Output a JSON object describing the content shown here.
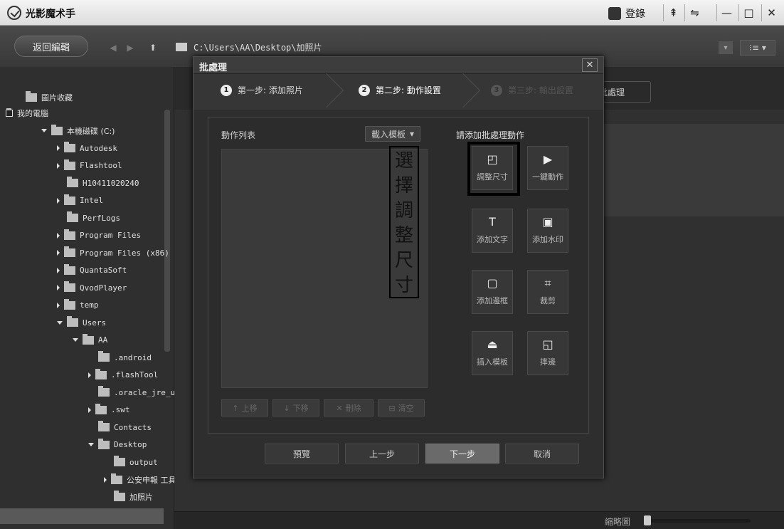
{
  "app": {
    "title": "光影魔术手",
    "login": "登錄"
  },
  "window_controls": [
    "⇞",
    "⇋",
    "—",
    "□",
    "✕"
  ],
  "toolbar": {
    "back_edit": "返回編輯",
    "path": "C:\\Users\\AA\\Desktop\\加照片",
    "view": "⁝≡ ▾"
  },
  "sidebar": {
    "items": [
      {
        "label": "圖片收藏",
        "indent": 0
      },
      {
        "label": "我的電腦",
        "indent": 0
      },
      {
        "label": "本機磁碟 (C:)",
        "indent": 1
      },
      {
        "label": "Autodesk",
        "indent": 2
      },
      {
        "label": "Flashtool",
        "indent": 2
      },
      {
        "label": "H10411020240",
        "indent": 2
      },
      {
        "label": "Intel",
        "indent": 2
      },
      {
        "label": "PerfLogs",
        "indent": 2
      },
      {
        "label": "Program Files",
        "indent": 2
      },
      {
        "label": "Program Files (x86)",
        "indent": 2
      },
      {
        "label": "QuantaSoft",
        "indent": 2
      },
      {
        "label": "QvodPlayer",
        "indent": 2
      },
      {
        "label": "temp",
        "indent": 2
      },
      {
        "label": "Users",
        "indent": 2
      },
      {
        "label": "AA",
        "indent": 3
      },
      {
        "label": ".android",
        "indent": 4
      },
      {
        "label": ".flashTool",
        "indent": 4
      },
      {
        "label": ".oracle_jre_usage",
        "indent": 4
      },
      {
        "label": ".swt",
        "indent": 4
      },
      {
        "label": "Contacts",
        "indent": 4
      },
      {
        "label": "Desktop",
        "indent": 4
      },
      {
        "label": "output",
        "indent": 5
      },
      {
        "label": "公安申報  工具",
        "indent": 5
      },
      {
        "label": "加照片",
        "indent": 5
      }
    ]
  },
  "main": {
    "batch_tab_partial": "批處理",
    "thumb_label": "縮略圖"
  },
  "dialog": {
    "title": "批處理",
    "close": "✕",
    "steps": [
      {
        "num": "1",
        "label": "第一步: 添加照片"
      },
      {
        "num": "2",
        "label": "第二步: 動作設置"
      },
      {
        "num": "3",
        "label": "第三步: 輸出設置"
      }
    ],
    "action_list_label": "動作列表",
    "load_template": "載入模板",
    "add_action_label": "請添加批處理動作",
    "list_buttons": [
      {
        "icon": "↑",
        "label": "上移"
      },
      {
        "icon": "↓",
        "label": "下移"
      },
      {
        "icon": "✕",
        "label": "刪除"
      },
      {
        "icon": "⊟",
        "label": "清空"
      }
    ],
    "actions": [
      {
        "icon": "◰",
        "label": "調整尺寸"
      },
      {
        "icon": "▶",
        "label": "一鍵動作"
      },
      {
        "icon": "T",
        "label": "添加文字"
      },
      {
        "icon": "▣",
        "label": "添加水印"
      },
      {
        "icon": "▢",
        "label": "添加邊框"
      },
      {
        "icon": "⌗",
        "label": "裁剪"
      },
      {
        "icon": "⏏",
        "label": "插入模板"
      },
      {
        "icon": "◱",
        "label": "摔邊"
      }
    ],
    "annotation": "選擇調整尺寸",
    "footer": {
      "preview": "預覽",
      "prev": "上一步",
      "next": "下一步",
      "cancel": "取消"
    }
  }
}
